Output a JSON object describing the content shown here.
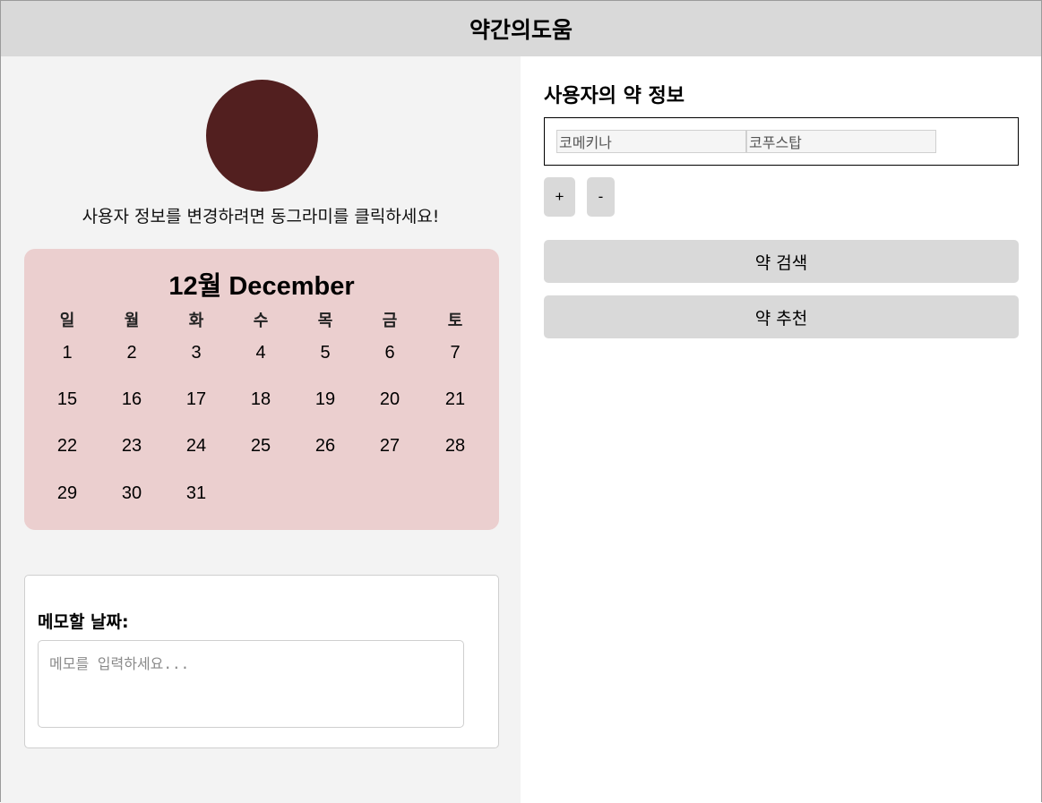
{
  "app": {
    "title": "약간의도움"
  },
  "profile": {
    "hint": "사용자 정보를 변경하려면 동그라미를 클릭하세요!",
    "avatar_color": "#521f1f"
  },
  "calendar": {
    "title": "12월 December",
    "background_color": "#ebcfcf",
    "weekdays": [
      "일",
      "월",
      "화",
      "수",
      "목",
      "금",
      "토"
    ],
    "weeks": [
      [
        "1",
        "2",
        "3",
        "4",
        "5",
        "6",
        "7"
      ],
      [
        "15",
        "16",
        "17",
        "18",
        "19",
        "20",
        "21"
      ],
      [
        "22",
        "23",
        "24",
        "25",
        "26",
        "27",
        "28"
      ],
      [
        "29",
        "30",
        "31"
      ]
    ]
  },
  "memo": {
    "label": "메모할 날짜:",
    "placeholder": "메모를 입력하세요..."
  },
  "medication": {
    "title": "사용자의 약 정보",
    "inputs": [
      {
        "value": "코메키나"
      },
      {
        "value": "코푸스탑"
      }
    ],
    "add_label": "+",
    "remove_label": "-",
    "search_label": "약 검색",
    "recommend_label": "약 추천"
  }
}
